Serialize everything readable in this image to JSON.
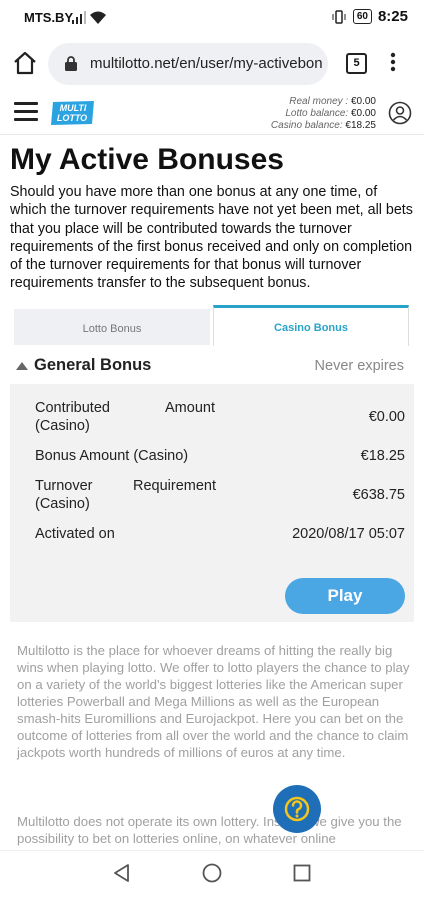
{
  "status_bar": {
    "carrier": "MTS.BY",
    "battery": "60",
    "time": "8:25"
  },
  "browser": {
    "url": "multilotto.net/en/user/my-activebonu",
    "tab_count": "5"
  },
  "header": {
    "logo_text": [
      "MULTI",
      "LOTTO"
    ],
    "balances": [
      {
        "label": "Real money :",
        "value": "€0.00"
      },
      {
        "label": "Lotto balance:",
        "value": "€0.00"
      },
      {
        "label": "Casino balance:",
        "value": "€18.25"
      }
    ]
  },
  "page": {
    "title": "My Active Bonuses",
    "intro": "Should you have more than one bonus at any one time, of which the turnover requirements have not yet been met, all bets that you place will be contributed towards the turnover requirements of the first bonus received and only on completion of the turnover requirements for that bonus will turnover requirements transfer to the subsequent bonus."
  },
  "tabs": {
    "lotto": "Lotto Bonus",
    "casino": "Casino Bonus"
  },
  "bonus": {
    "title": "General Bonus",
    "expires": "Never expires",
    "rows": [
      {
        "label_a": "Contributed",
        "label_b": "Amount",
        "label_c": "(Casino)",
        "value": "€0.00"
      },
      {
        "label": "Bonus Amount (Casino)",
        "value": "€18.25"
      },
      {
        "label_a": "Turnover",
        "label_b": "Requirement",
        "label_c": "(Casino)",
        "value": "€638.75"
      },
      {
        "label": "Activated on",
        "value": "2020/08/17 05:07"
      }
    ],
    "play_label": "Play"
  },
  "about": {
    "p1": "Multilotto is the place for whoever dreams of hitting the really big wins when playing lotto. We offer to lotto players the chance to play on a variety of the world's biggest lotteries like the American super lotteries Powerball and Mega Millions as well as the European smash-hits Euromillions and Eurojackpot. Here you can bet on the outcome of lotteries from all over the world and the chance to claim jackpots worth hundreds of millions of euros at any time.",
    "p2": "Multilotto does not operate its own lottery. Instead we give you the possibility to bet on lotteries online, on whatever online"
  },
  "colors": {
    "accent": "#2aa3c9",
    "play": "#4aa7e4",
    "help": "#1f6fb8",
    "help_glyph": "#f5c518"
  }
}
